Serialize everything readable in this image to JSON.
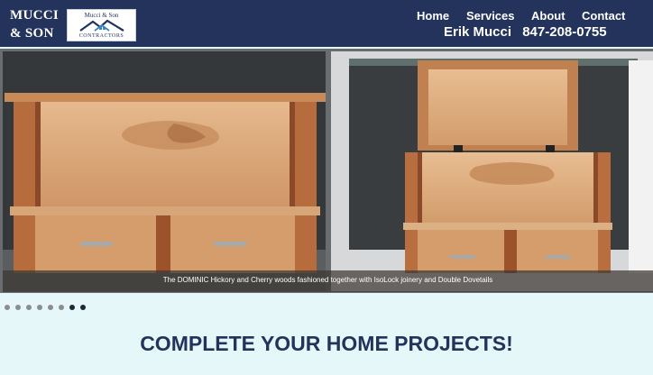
{
  "brand": {
    "name_line1": "MUCCI",
    "name_line2": "& SON",
    "logo_top": "Mucci & Son",
    "logo_bottom": "CONTRACTORS",
    "logo_icon": "house-roof-icon"
  },
  "nav": {
    "items": [
      {
        "label": "Home"
      },
      {
        "label": "Services"
      },
      {
        "label": "About"
      },
      {
        "label": "Contact"
      }
    ]
  },
  "contact": {
    "name": "Erik Mucci",
    "phone": "847-208-0755"
  },
  "slider": {
    "caption": "The DOMINIC Hickory and Cherry woods fashioned together with IsoLock joinery and Double Dovetails",
    "dot_count": 8,
    "active_dots": [
      6,
      7
    ]
  },
  "main": {
    "headline": "COMPLETE YOUR HOME PROJECTS!"
  },
  "colors": {
    "header_bg": "#23335c",
    "page_bg": "#e6f7f9",
    "headline": "#23335c",
    "wood_light": "#d9a779",
    "wood_dark": "#a3542b"
  }
}
